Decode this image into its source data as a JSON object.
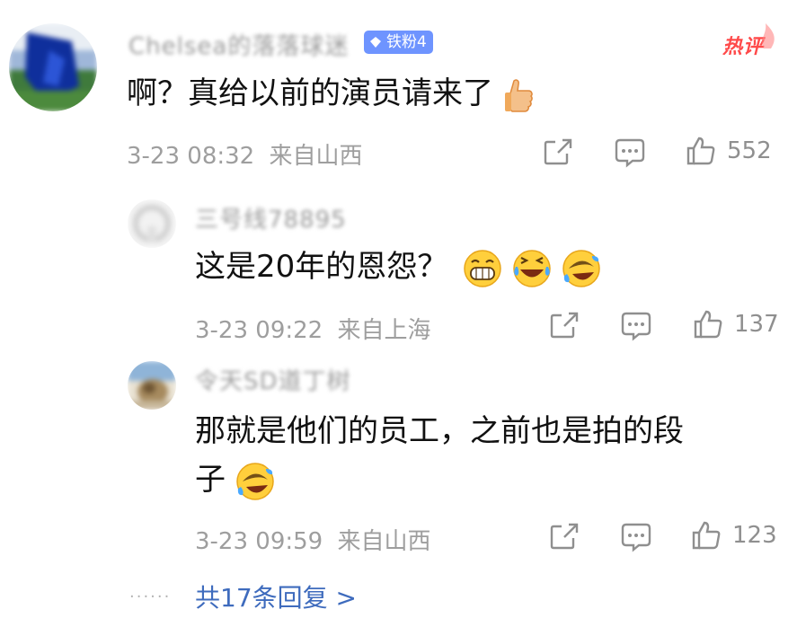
{
  "comment": {
    "username": "Chelsea的落落球迷",
    "badge_label": "铁粉4",
    "hot_label": "热评",
    "text": "啊？真给以前的演员请来了",
    "emoji": "thumbs-up",
    "time": "3-23 08:32",
    "location": "来自山西",
    "likes": "552"
  },
  "replies": [
    {
      "username": "三号线78895",
      "text": "这是20年的恩怨？",
      "emojis": [
        "grin",
        "laugh-cry",
        "rofl"
      ],
      "time": "3-23 09:22",
      "location": "来自上海",
      "likes": "137"
    },
    {
      "username": "令天SD道丁树",
      "text_line1": "那就是他们的员工，之前也是拍的段",
      "text_line2": "子",
      "emoji": "rofl",
      "time": "3-23 09:59",
      "location": "来自山西",
      "likes": "123"
    }
  ],
  "footer": {
    "dots": "······",
    "more_label": "共17条回复 >"
  },
  "colors": {
    "accent_blue": "#3e6bbd",
    "badge_blue": "#6e94ff",
    "hot_red": "#ff4a4a",
    "meta_gray": "#9e9e9e"
  },
  "icons": [
    "share-icon",
    "comment-icon",
    "like-icon"
  ]
}
